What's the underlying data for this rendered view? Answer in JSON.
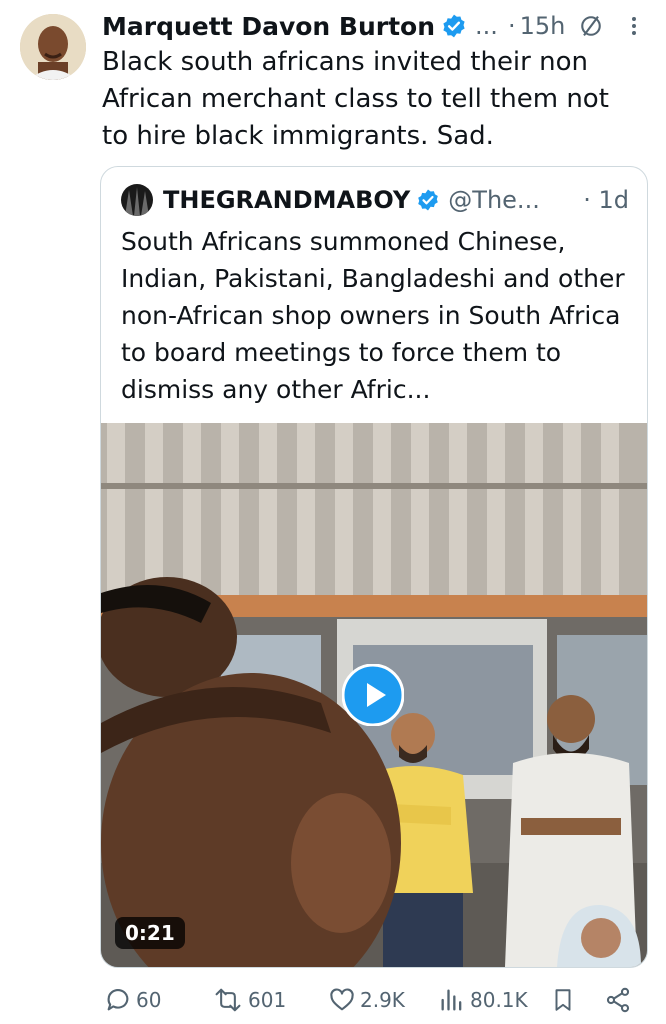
{
  "tweet": {
    "author_name": "Marquett Davon Burton",
    "truncated": "...",
    "separator": "·",
    "time": "15h",
    "text": "Black south africans invited their non African merchant class to tell them not to hire black immigrants. Sad."
  },
  "quote": {
    "name": "THEGRANDMABOY",
    "handle": "@The...",
    "separator": "·",
    "time": "1d",
    "text": "South Africans summoned Chinese, Indian, Pakistani, Bangladeshi and other non-African shop owners in South Africa to board meetings to force them to dismiss any other Afric...",
    "video_duration": "0:21"
  },
  "actions": {
    "replies": "60",
    "reposts": "601",
    "likes": "2.9K",
    "views": "80.1K"
  },
  "icons": [
    "verified-badge-icon",
    "no-reply-icon",
    "more-icon",
    "play-icon",
    "reply-icon",
    "repost-icon",
    "like-icon",
    "views-icon",
    "bookmark-icon",
    "share-icon"
  ],
  "colors": {
    "text": "#0f1419",
    "muted": "#536471",
    "verified": "#1d9bf0",
    "border": "#cfd9de"
  }
}
